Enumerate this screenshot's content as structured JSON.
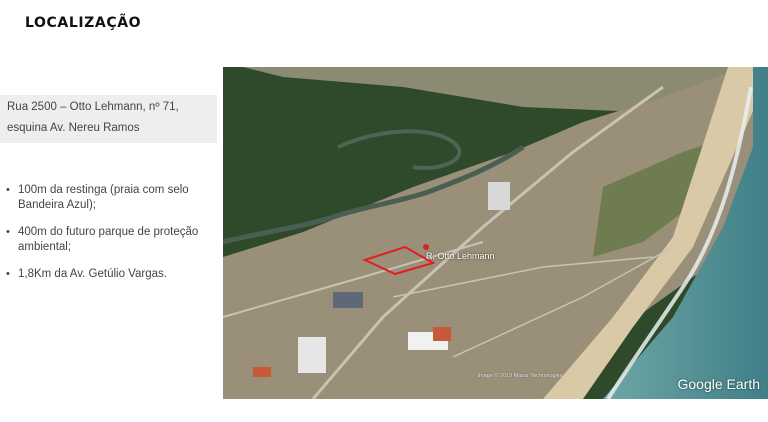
{
  "page": {
    "title": "LOCALIZAÇÃO"
  },
  "address": {
    "line1": "Rua 2500 – Otto Lehmann, nº 71,",
    "line2": "esquina Av. Nereu Ramos"
  },
  "highlights": [
    {
      "text": "100m da restinga (praia com selo Bandeira Azul);"
    },
    {
      "text": "400m do futuro parque de proteção ambiental;"
    },
    {
      "text": "1,8Km da Av. Getúlio Vargas."
    }
  ],
  "map": {
    "street_label": "R. Otto Lehmann",
    "credit": "Image © 2019 Maxar Technologies",
    "logo": "Google Earth",
    "colors": {
      "forest": "#2f4a2c",
      "sea": "#4f8f95",
      "beach": "#d8c9a8",
      "marker": "#e02020"
    }
  }
}
